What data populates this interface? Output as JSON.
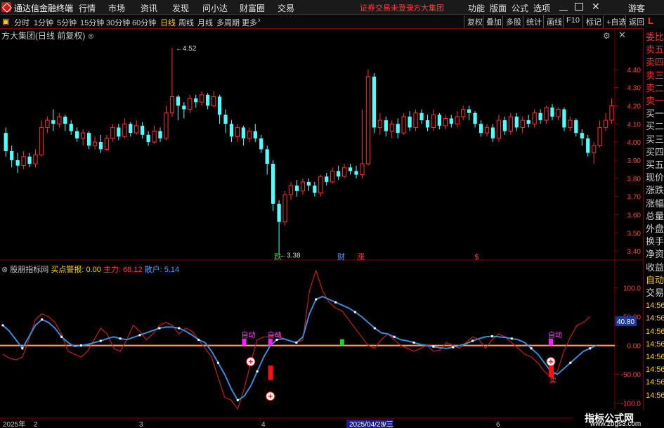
{
  "app": {
    "title": "通达信金融终端",
    "menus": [
      "行情",
      "市场",
      "资讯",
      "发现",
      "问小达",
      "财富圈",
      "交易"
    ],
    "session_warning": "证券交易未登录",
    "broker": "方大集团",
    "right_menus": [
      "功能",
      "版面",
      "公式",
      "选项"
    ],
    "guest": "游客"
  },
  "periods": [
    "分时",
    "1分钟",
    "5分钟",
    "15分钟",
    "30分钟",
    "60分钟",
    "日线",
    "周线",
    "月线",
    "多周期",
    "更多"
  ],
  "active_period": "日线",
  "tools": [
    "复权",
    "叠加",
    "多股",
    "统计",
    "画线",
    "F10",
    "标记",
    "+自选",
    "返回"
  ],
  "stock": {
    "name": "方大集团",
    "mode": "(日线 前复权)"
  },
  "price_axis": [
    "4.40",
    "4.30",
    "4.20",
    "4.10",
    "4.00",
    "3.90",
    "3.80",
    "3.70",
    "3.60",
    "3.50",
    "3.40"
  ],
  "high_label": "4.52",
  "low_label": "3.38",
  "event_marks": [
    {
      "text": "跌",
      "color": "#40c040"
    },
    {
      "text": "财",
      "color": "#60a0ff"
    },
    {
      "text": "涨",
      "color": "#ff4040"
    },
    {
      "text": "$",
      "color": "#ff4040"
    }
  ],
  "indicator": {
    "name": "股朋指标网",
    "l1": "买点警报: 0.00",
    "l2": "主力: 68.12",
    "l3": "散户: 5.14"
  },
  "ind_axis": [
    "100.0",
    "50.00",
    "0.00",
    "-50.00",
    "-100.0"
  ],
  "ind_current": "40.80",
  "auto_labels": [
    "自动",
    "自动",
    "自动"
  ],
  "sell_label": "卖",
  "time_axis": [
    "2025年",
    "2",
    "3",
    "4",
    "2025/04/23/三",
    "5",
    "6"
  ],
  "right_panel": [
    "委比",
    "卖五",
    "卖四",
    "卖三",
    "卖二",
    "卖一",
    "买一",
    "买二",
    "买三",
    "买四",
    "买五",
    "现价",
    "涨跌",
    "涨幅",
    "总量",
    "外盘",
    "换手",
    "净资",
    "收益",
    "自动",
    "交易",
    "14:56",
    "14:56",
    "14:56",
    "14:56",
    "14:56",
    "14:56",
    "14:56",
    "14:56"
  ],
  "right_L": "L",
  "watermark": {
    "title": "指标公式网",
    "url": "www.zbgs3.com"
  },
  "chart_data": {
    "type": "candlestick",
    "ylim": [
      3.35,
      4.55
    ],
    "candles": [
      [
        4.05,
        3.95,
        4.08,
        3.92
      ],
      [
        3.95,
        3.9,
        3.98,
        3.86
      ],
      [
        3.9,
        3.87,
        3.94,
        3.83
      ],
      [
        3.87,
        3.92,
        3.95,
        3.85
      ],
      [
        3.92,
        3.88,
        3.94,
        3.86
      ],
      [
        3.88,
        3.93,
        3.96,
        3.86
      ],
      [
        3.93,
        4.08,
        4.12,
        3.92
      ],
      [
        4.08,
        4.12,
        4.14,
        4.05
      ],
      [
        4.12,
        4.1,
        4.18,
        4.06
      ],
      [
        4.1,
        4.14,
        4.16,
        4.08
      ],
      [
        4.14,
        4.1,
        4.15,
        4.06
      ],
      [
        4.1,
        4.06,
        4.12,
        4.04
      ],
      [
        4.06,
        4.02,
        4.08,
        4.0
      ],
      [
        4.02,
        4.05,
        4.07,
        3.98
      ],
      [
        4.05,
        3.98,
        4.06,
        3.96
      ],
      [
        3.98,
        4.0,
        4.03,
        3.96
      ],
      [
        4.0,
        3.96,
        4.04,
        3.94
      ],
      [
        3.96,
        4.02,
        4.04,
        3.95
      ],
      [
        4.02,
        4.08,
        4.1,
        4.0
      ],
      [
        4.08,
        4.03,
        4.1,
        4.01
      ],
      [
        4.03,
        4.1,
        4.13,
        4.02
      ],
      [
        4.1,
        4.05,
        4.11,
        4.03
      ],
      [
        4.05,
        4.09,
        4.12,
        4.04
      ],
      [
        4.09,
        4.04,
        4.11,
        4.02
      ],
      [
        4.04,
        4.0,
        4.06,
        3.98
      ],
      [
        4.0,
        4.06,
        4.09,
        3.99
      ],
      [
        4.06,
        4.02,
        4.08,
        4.0
      ],
      [
        4.02,
        4.16,
        4.2,
        4.01
      ],
      [
        4.16,
        4.25,
        4.52,
        4.14
      ],
      [
        4.25,
        4.2,
        4.26,
        4.12
      ],
      [
        4.2,
        4.18,
        4.22,
        4.13
      ],
      [
        4.18,
        4.24,
        4.26,
        4.16
      ],
      [
        4.24,
        4.22,
        4.26,
        4.19
      ],
      [
        4.22,
        4.26,
        4.28,
        4.2
      ],
      [
        4.26,
        4.2,
        4.27,
        4.18
      ],
      [
        4.2,
        4.25,
        4.28,
        4.19
      ],
      [
        4.25,
        4.15,
        4.26,
        4.1
      ],
      [
        4.15,
        4.1,
        4.18,
        4.05
      ],
      [
        4.1,
        4.03,
        4.12,
        4.0
      ],
      [
        4.03,
        4.08,
        4.1,
        4.0
      ],
      [
        4.08,
        4.02,
        4.09,
        3.98
      ],
      [
        4.02,
        4.06,
        4.08,
        4.0
      ],
      [
        4.06,
        4.02,
        4.1,
        4.0
      ],
      [
        4.02,
        3.96,
        4.04,
        3.94
      ],
      [
        3.96,
        3.88,
        3.98,
        3.82
      ],
      [
        3.88,
        3.66,
        3.9,
        3.62
      ],
      [
        3.66,
        3.56,
        3.68,
        3.38
      ],
      [
        3.56,
        3.71,
        3.73,
        3.54
      ],
      [
        3.71,
        3.76,
        3.78,
        3.68
      ],
      [
        3.76,
        3.73,
        3.79,
        3.7
      ],
      [
        3.73,
        3.78,
        3.8,
        3.71
      ],
      [
        3.78,
        3.76,
        3.8,
        3.73
      ],
      [
        3.76,
        3.72,
        3.78,
        3.7
      ],
      [
        3.72,
        3.81,
        3.82,
        3.7
      ],
      [
        3.81,
        3.78,
        3.83,
        3.76
      ],
      [
        3.78,
        3.84,
        3.86,
        3.77
      ],
      [
        3.84,
        3.81,
        3.87,
        3.79
      ],
      [
        3.81,
        3.86,
        3.88,
        3.8
      ],
      [
        3.86,
        3.84,
        3.88,
        3.82
      ],
      [
        3.84,
        3.82,
        3.87,
        3.8
      ],
      [
        3.82,
        3.88,
        4.18,
        3.8
      ],
      [
        3.88,
        4.36,
        4.4,
        3.87
      ],
      [
        4.36,
        4.08,
        4.38,
        4.05
      ],
      [
        4.08,
        4.12,
        4.16,
        4.04
      ],
      [
        4.12,
        4.06,
        4.14,
        4.03
      ],
      [
        4.06,
        4.1,
        4.12,
        4.02
      ],
      [
        4.1,
        4.05,
        4.13,
        4.02
      ],
      [
        4.05,
        4.14,
        4.16,
        4.04
      ],
      [
        4.14,
        4.08,
        4.17,
        4.06
      ],
      [
        4.08,
        4.16,
        4.18,
        4.06
      ],
      [
        4.16,
        4.12,
        4.18,
        4.1
      ],
      [
        4.12,
        4.08,
        4.15,
        4.06
      ],
      [
        4.08,
        4.15,
        4.18,
        4.06
      ],
      [
        4.15,
        4.09,
        4.16,
        4.07
      ],
      [
        4.09,
        4.13,
        4.15,
        4.07
      ],
      [
        4.13,
        4.1,
        4.15,
        4.08
      ],
      [
        4.1,
        4.14,
        4.17,
        4.08
      ],
      [
        4.14,
        4.18,
        4.2,
        4.12
      ],
      [
        4.18,
        4.16,
        4.2,
        4.12
      ],
      [
        4.16,
        4.1,
        4.17,
        4.08
      ],
      [
        4.1,
        4.05,
        4.12,
        4.03
      ],
      [
        4.05,
        4.08,
        4.1,
        4.03
      ],
      [
        4.08,
        4.02,
        4.1,
        4.0
      ],
      [
        4.02,
        4.12,
        4.15,
        4.0
      ],
      [
        4.12,
        4.06,
        4.14,
        4.04
      ],
      [
        4.06,
        4.14,
        4.16,
        4.04
      ],
      [
        4.14,
        4.08,
        4.16,
        4.06
      ],
      [
        4.08,
        4.12,
        4.14,
        4.05
      ],
      [
        4.12,
        4.1,
        4.15,
        4.08
      ],
      [
        4.1,
        4.16,
        4.18,
        4.08
      ],
      [
        4.16,
        4.12,
        4.18,
        4.1
      ],
      [
        4.12,
        4.19,
        4.2,
        4.1
      ],
      [
        4.19,
        4.14,
        4.21,
        4.12
      ],
      [
        4.14,
        4.18,
        4.19,
        4.12
      ],
      [
        4.18,
        4.08,
        4.19,
        4.06
      ],
      [
        4.08,
        4.12,
        4.14,
        4.06
      ],
      [
        4.12,
        4.05,
        4.13,
        4.03
      ],
      [
        4.05,
        4.02,
        4.07,
        3.98
      ],
      [
        4.02,
        3.94,
        4.04,
        3.92
      ],
      [
        3.94,
        3.98,
        4.0,
        3.88
      ],
      [
        3.98,
        4.08,
        4.12,
        3.97
      ],
      [
        4.08,
        4.12,
        4.16,
        4.06
      ],
      [
        4.12,
        4.2,
        4.24,
        4.1
      ]
    ],
    "indicator_blue": [
      35,
      25,
      10,
      -5,
      15,
      35,
      45,
      40,
      30,
      15,
      5,
      -2,
      0,
      2,
      5,
      8,
      12,
      15,
      12,
      10,
      14,
      18,
      22,
      26,
      30,
      32,
      32,
      30,
      25,
      18,
      10,
      5,
      -10,
      -30,
      -50,
      -75,
      -95,
      -88,
      -70,
      -45,
      -20,
      0,
      10,
      12,
      8,
      5,
      15,
      55,
      80,
      85,
      80,
      75,
      70,
      65,
      58,
      50,
      40,
      30,
      22,
      20,
      15,
      10,
      8,
      5,
      2,
      0,
      -2,
      -4,
      -5,
      -3,
      0,
      3,
      8,
      12,
      15,
      16,
      15,
      14,
      12,
      10,
      5,
      -5,
      -15,
      -30,
      -45,
      -50,
      -40,
      -30,
      -20,
      -10,
      -5,
      0
    ],
    "indicator_red": [
      -15,
      -22,
      -25,
      -20,
      10,
      45,
      55,
      50,
      40,
      20,
      -10,
      -15,
      -20,
      -10,
      10,
      30,
      20,
      -5,
      -10,
      10,
      35,
      25,
      10,
      20,
      35,
      40,
      35,
      20,
      30,
      25,
      10,
      -5,
      -20,
      -55,
      -90,
      -95,
      -110,
      -75,
      -30,
      10,
      15,
      15,
      20,
      12,
      8,
      5,
      10,
      95,
      130,
      95,
      75,
      65,
      60,
      45,
      30,
      15,
      0,
      -5,
      10,
      20,
      10,
      0,
      -5,
      -10,
      -5,
      0,
      -10,
      -8,
      5,
      0,
      -5,
      5,
      15,
      10,
      -5,
      10,
      20,
      15,
      5,
      -5,
      -15,
      -20,
      -30,
      -45,
      -55,
      -45,
      -10,
      15,
      35,
      40,
      50
    ]
  }
}
